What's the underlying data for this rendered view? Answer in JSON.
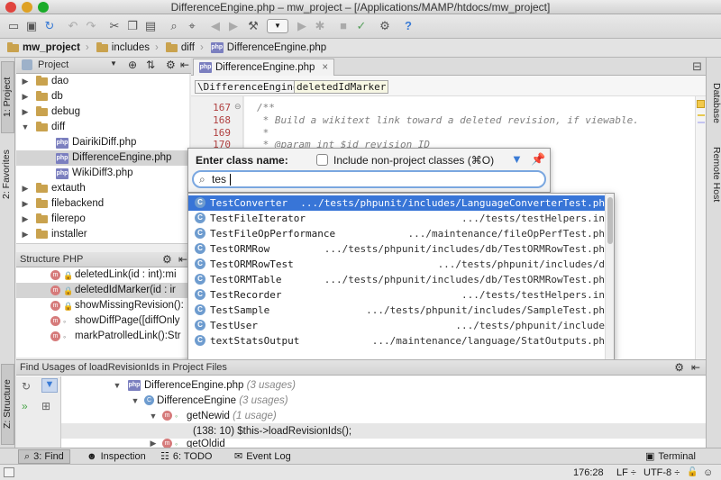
{
  "window": {
    "title": "DifferenceEngine.php – mw_project – [/Applications/MAMP/htdocs/mw_project]"
  },
  "navbar": {
    "crumbs": [
      "mw_project",
      "includes",
      "diff",
      "DifferenceEngine.php"
    ]
  },
  "left_tabs": {
    "project": "1: Project",
    "favorites": "2: Favorites",
    "structure": "Z: Structure"
  },
  "right_tabs": {
    "database": "Database",
    "remote_host": "Remote Host"
  },
  "project_panel": {
    "title": "Project",
    "items": [
      {
        "label": "dao",
        "type": "folder",
        "expanded": false
      },
      {
        "label": "db",
        "type": "folder",
        "expanded": false
      },
      {
        "label": "debug",
        "type": "folder",
        "expanded": false
      },
      {
        "label": "diff",
        "type": "folder",
        "expanded": true
      },
      {
        "label": "DairikiDiff.php",
        "type": "php"
      },
      {
        "label": "DifferenceEngine.php",
        "type": "php",
        "selected": true
      },
      {
        "label": "WikiDiff3.php",
        "type": "php"
      },
      {
        "label": "extauth",
        "type": "folder",
        "expanded": false
      },
      {
        "label": "filebackend",
        "type": "folder",
        "expanded": false
      },
      {
        "label": "filerepo",
        "type": "folder",
        "expanded": false
      },
      {
        "label": "installer",
        "type": "folder",
        "expanded": false
      }
    ]
  },
  "structure_panel": {
    "title": "Structure PHP",
    "items": [
      "deletedLink(id : int):mi",
      "deletedIdMarker(id : ir",
      "showMissingRevision():",
      "showDiffPage([diffOnly",
      "markPatrolledLink():Str"
    ]
  },
  "editor": {
    "tab": "DifferenceEngine.php",
    "breadcrumbs": [
      "\\DifferenceEngine",
      "deletedIdMarker"
    ],
    "lines": [
      {
        "num": "167",
        "text": "/**"
      },
      {
        "num": "168",
        "text": " * Build a wikitext link toward a deleted revision, if viewable."
      },
      {
        "num": "169",
        "text": " *"
      },
      {
        "num": "170",
        "text": " * @param int $id revision ID"
      }
    ]
  },
  "class_popup": {
    "label": "Enter class name:",
    "checkbox_label": "Include non-project classes (⌘O)",
    "query": "tes",
    "results": [
      {
        "name": "TestConverter",
        "path": ".../tests/phpunit/includes/LanguageConverterTest.ph"
      },
      {
        "name": "TestFileIterator",
        "path": ".../tests/testHelpers.in"
      },
      {
        "name": "TestFileOpPerformance",
        "path": ".../maintenance/fileOpPerfTest.ph"
      },
      {
        "name": "TestORMRow",
        "path": ".../tests/phpunit/includes/db/TestORMRowTest.ph"
      },
      {
        "name": "TestORMRowTest",
        "path": ".../tests/phpunit/includes/d"
      },
      {
        "name": "TestORMTable",
        "path": ".../tests/phpunit/includes/db/TestORMRowTest.ph"
      },
      {
        "name": "TestRecorder",
        "path": ".../tests/testHelpers.in"
      },
      {
        "name": "TestSample",
        "path": ".../tests/phpunit/includes/SampleTest.ph"
      },
      {
        "name": "TestUser",
        "path": ".../tests/phpunit/include"
      },
      {
        "name": "textStatsOutput",
        "path": ".../maintenance/language/StatOutputs.ph"
      }
    ]
  },
  "find_panel": {
    "title_prefix": "Find Usages of",
    "title_target": "loadRevisionIds",
    "title_suffix": "in Project Files",
    "rows": [
      {
        "label": "DifferenceEngine.php",
        "count": "(3 usages)"
      },
      {
        "label": "DifferenceEngine",
        "count": "(3 usages)"
      },
      {
        "label": "getNewid",
        "count": "(1 usage)"
      },
      {
        "label": "(138: 10) $this->loadRevisionIds();"
      },
      {
        "label": "getOldid"
      }
    ]
  },
  "bottom_tabs": [
    "3: Find",
    "Inspection",
    "6: TODO",
    "Event Log",
    "Terminal"
  ],
  "status": {
    "position": "176:28",
    "line_sep": "LF ÷",
    "encoding": "UTF-8 ÷"
  },
  "colors": {
    "selection": "#3875d7",
    "comment": "#808080",
    "line_number": "#b04040"
  }
}
